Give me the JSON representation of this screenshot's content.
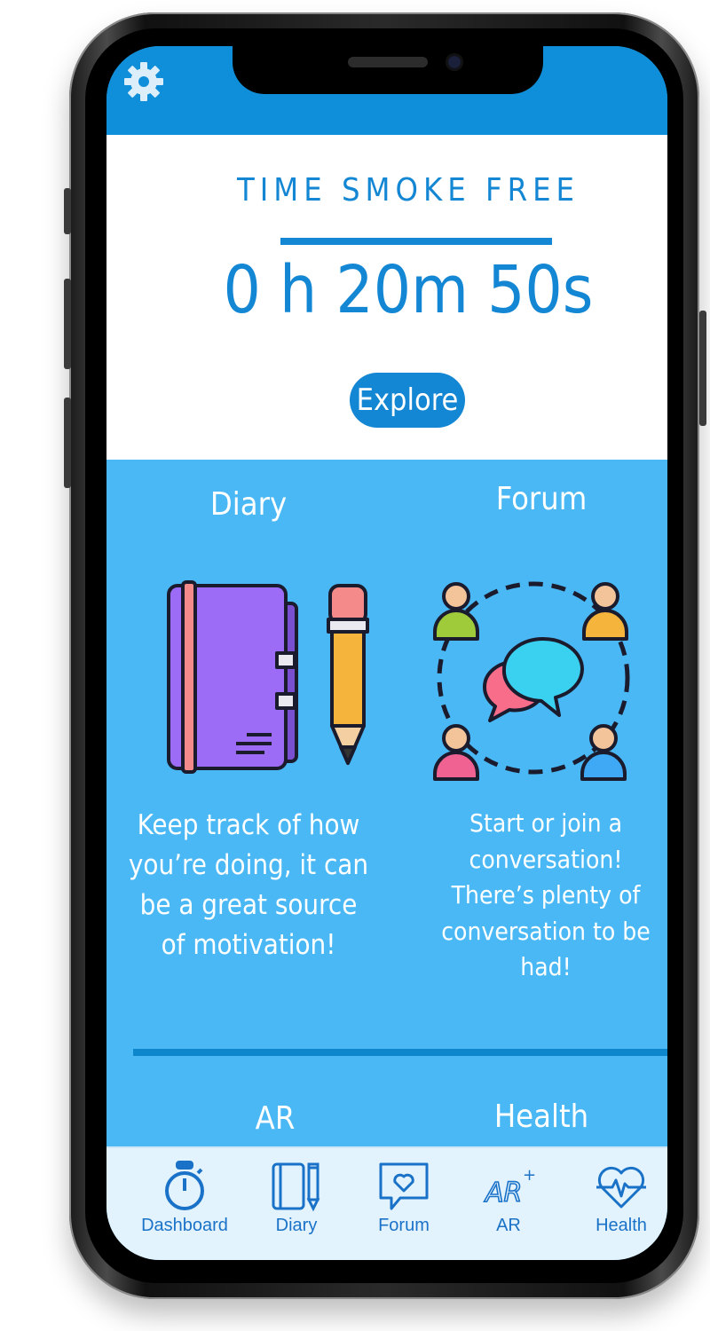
{
  "header": {
    "settings_icon": "gear-icon"
  },
  "timer": {
    "title": "TIME SMOKE FREE",
    "elapsed": "0 h 20m 50s",
    "explore_label": "Explore"
  },
  "cards": [
    {
      "id": "diary",
      "title": "Diary",
      "description": "Keep track of how you’re doing, it can be a great source of motivation!"
    },
    {
      "id": "forum",
      "title": "Forum",
      "description": "Start or join a conversation! There’s plenty of conversation to be had!"
    },
    {
      "id": "ar",
      "title": "AR"
    },
    {
      "id": "health",
      "title": "Health"
    }
  ],
  "tabs": [
    {
      "label": "Dashboard",
      "icon": "stopwatch-icon"
    },
    {
      "label": "Diary",
      "icon": "notebook-icon"
    },
    {
      "label": "Forum",
      "icon": "chat-heart-icon"
    },
    {
      "label": "AR",
      "icon": "ar-icon"
    },
    {
      "label": "Health",
      "icon": "heartbeat-icon"
    }
  ],
  "colors": {
    "primary": "#1487d4",
    "topbar": "#0f8ed9",
    "content_bg": "#4ab8f5",
    "tabbar_bg": "#e3f3fd"
  }
}
